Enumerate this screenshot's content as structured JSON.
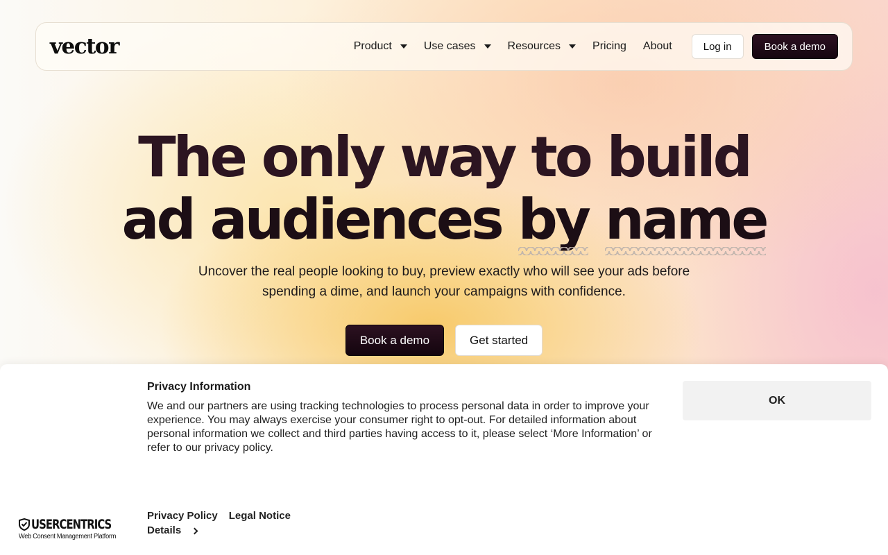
{
  "nav": {
    "logo": "vector",
    "items": [
      {
        "label": "Product",
        "has_dropdown": true
      },
      {
        "label": "Use cases",
        "has_dropdown": true
      },
      {
        "label": "Resources",
        "has_dropdown": true
      },
      {
        "label": "Pricing",
        "has_dropdown": false
      },
      {
        "label": "About",
        "has_dropdown": false
      }
    ],
    "login_label": "Log in",
    "demo_label": "Book a demo"
  },
  "hero": {
    "title_line1": "The only way to build",
    "title_line2_a": "ad audiences",
    "title_line2_b": "by",
    "title_line2_c": "name",
    "subtitle": "Uncover the real people looking to buy, preview exactly who will see your ads before spending a dime, and launch your campaigns with confidence.",
    "cta_primary": "Book a demo",
    "cta_secondary": "Get started"
  },
  "consent": {
    "title": "Privacy Information",
    "body": "We and our partners are using tracking technologies to process personal data in order to improve your experience. You may always exercise your consumer right to opt-out. For detailed information about personal information we collect and third parties having access to it, please select ‘More Information’ or refer to our privacy policy.",
    "ok_label": "OK",
    "privacy_policy_label": "Privacy Policy",
    "legal_notice_label": "Legal Notice",
    "details_label": "Details",
    "brand_name": "USERCENTRICS",
    "brand_tagline": "Web Consent Management Platform"
  },
  "colors": {
    "accent_dark": "#1c0a14",
    "title_color": "#2c1521"
  }
}
